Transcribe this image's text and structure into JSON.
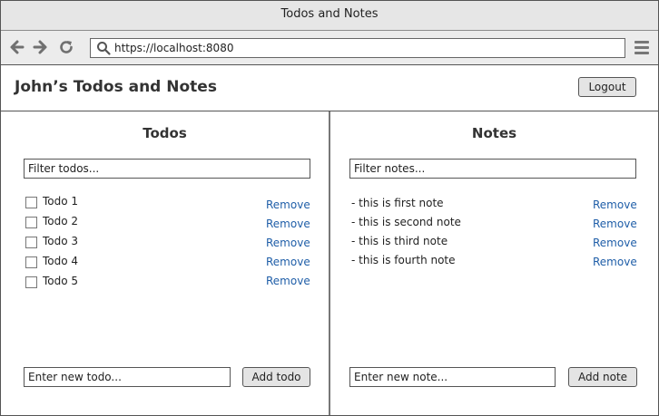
{
  "window": {
    "title": "Todos and Notes"
  },
  "browser": {
    "url": "https://localhost:8080",
    "icons": [
      "back-arrow-icon",
      "forward-arrow-icon",
      "reload-icon",
      "search-icon",
      "hamburger-menu-icon"
    ]
  },
  "header": {
    "title": "John’s Todos and Notes",
    "logout_label": "Logout"
  },
  "todos": {
    "title": "Todos",
    "filter_placeholder": "Filter todos...",
    "items": [
      {
        "label": "Todo 1",
        "checked": false,
        "remove_label": "Remove"
      },
      {
        "label": "Todo 2",
        "checked": false,
        "remove_label": "Remove"
      },
      {
        "label": "Todo 3",
        "checked": false,
        "remove_label": "Remove"
      },
      {
        "label": "Todo 4",
        "checked": false,
        "remove_label": "Remove"
      },
      {
        "label": "Todo 5",
        "checked": false,
        "remove_label": "Remove"
      }
    ],
    "new_placeholder": "Enter new todo...",
    "add_label": "Add todo"
  },
  "notes": {
    "title": "Notes",
    "filter_placeholder": "Filter notes...",
    "items": [
      {
        "label": "- this is first note",
        "remove_label": "Remove"
      },
      {
        "label": "- this is second note",
        "remove_label": "Remove"
      },
      {
        "label": "- this is third note",
        "remove_label": "Remove"
      },
      {
        "label": "- this is fourth note",
        "remove_label": "Remove"
      }
    ],
    "new_placeholder": "Enter new note...",
    "add_label": "Add note"
  },
  "colors": {
    "link": "#1f5ea8",
    "chrome": "#e6e6e6",
    "button": "#e4e4e4"
  }
}
